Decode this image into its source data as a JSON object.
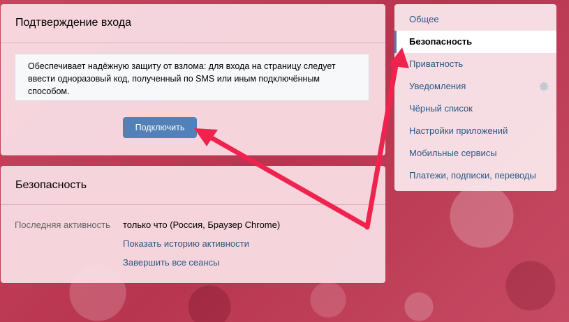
{
  "login_confirmation": {
    "title": "Подтверждение входа",
    "notice_line1": "Обеспечивает надёжную защиту от взлома: для входа на страницу следует",
    "notice_line2": "ввести одноразовый код, полученный по SMS или иным подключённым",
    "notice_line3": "способом.",
    "connect_button": "Подключить"
  },
  "security": {
    "title": "Безопасность",
    "last_activity_label": "Последняя активность",
    "last_activity_value": "только что (Россия, Браузер Chrome)",
    "show_history_link": "Показать историю активности",
    "end_sessions_link": "Завершить все сеансы"
  },
  "settings_menu": {
    "items": [
      {
        "label": "Общее"
      },
      {
        "label": "Безопасность"
      },
      {
        "label": "Приватность"
      },
      {
        "label": "Уведомления"
      },
      {
        "label": "Чёрный список"
      },
      {
        "label": "Настройки приложений"
      },
      {
        "label": "Мобильные сервисы"
      },
      {
        "label": "Платежи, подписки, переводы"
      }
    ],
    "active_item": "Безопасность",
    "notifications_icon": "gear-icon"
  },
  "annotation": {
    "arrow_color": "#f0234f"
  },
  "colors": {
    "accent": "#5181b8",
    "link": "#2a5885",
    "background": "#c9455f"
  }
}
